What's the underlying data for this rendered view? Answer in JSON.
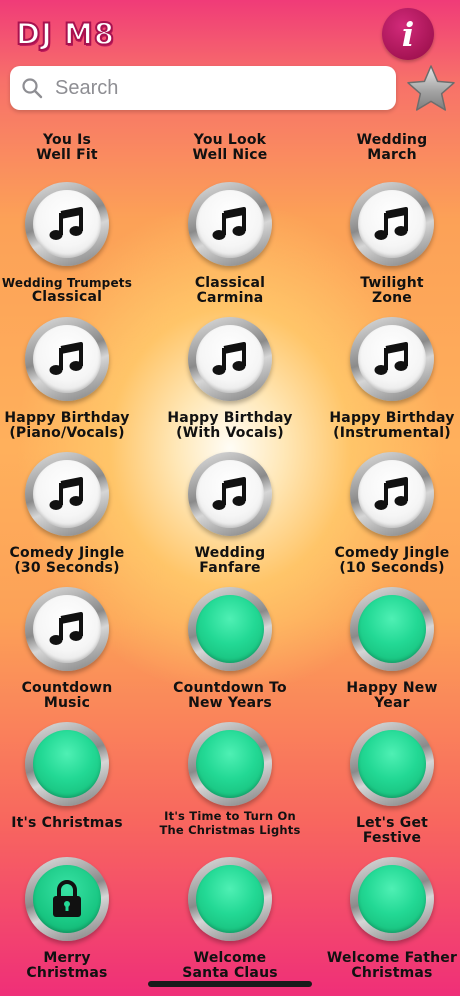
{
  "header": {
    "title": "DJ M8",
    "info_icon": "info-icon"
  },
  "search": {
    "placeholder": "Search"
  },
  "favorites": {
    "icon": "star-icon"
  },
  "top_row": [
    {
      "line1": "You Is",
      "line2": "Well Fit"
    },
    {
      "line1": "You Look",
      "line2": "Well Nice"
    },
    {
      "line1": "Wedding",
      "line2": "March"
    }
  ],
  "rows": [
    [
      {
        "line1": "Wedding Trumpets",
        "line2": "Classical",
        "style": "music"
      },
      {
        "line1": "Classical",
        "line2": "Carmina",
        "style": "music"
      },
      {
        "line1": "Twilight",
        "line2": "Zone",
        "style": "music"
      }
    ],
    [
      {
        "line1": "Happy Birthday",
        "line2": "(Piano/Vocals)",
        "style": "music"
      },
      {
        "line1": "Happy Birthday",
        "line2": "(With Vocals)",
        "style": "music"
      },
      {
        "line1": "Happy Birthday",
        "line2": "(Instrumental)",
        "style": "music"
      }
    ],
    [
      {
        "line1": "Comedy Jingle",
        "line2": "(30 Seconds)",
        "style": "music"
      },
      {
        "line1": "Wedding",
        "line2": "Fanfare",
        "style": "music"
      },
      {
        "line1": "Comedy Jingle",
        "line2": "(10 Seconds)",
        "style": "music"
      }
    ],
    [
      {
        "line1": "Countdown",
        "line2": "Music",
        "style": "music"
      },
      {
        "line1": "Countdown To",
        "line2": "New Years",
        "style": "green"
      },
      {
        "line1": "Happy New",
        "line2": "Year",
        "style": "green"
      }
    ],
    [
      {
        "line1": "It's Christmas",
        "line2": "",
        "style": "green"
      },
      {
        "line1": "It's Time to Turn On",
        "line2": "The Christmas Lights",
        "style": "green"
      },
      {
        "line1": "Let's Get",
        "line2": "Festive",
        "style": "green"
      }
    ],
    [
      {
        "line1": "Merry",
        "line2": "Christmas",
        "style": "locked"
      },
      {
        "line1": "Welcome",
        "line2": "Santa Claus",
        "style": "green"
      },
      {
        "line1": "Welcome Father",
        "line2": "Christmas",
        "style": "green"
      }
    ]
  ],
  "colors": {
    "accent": "#a8124f",
    "green_button": "#23d995"
  }
}
